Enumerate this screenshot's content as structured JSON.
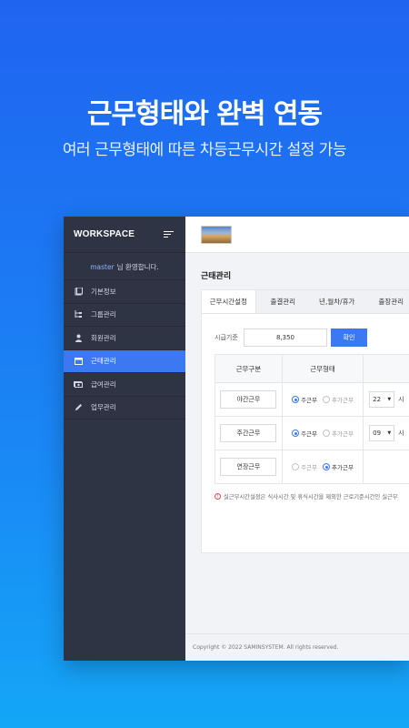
{
  "headline": "근무형태와 완벽 연동",
  "subline": "여러 근무형태에 따른 차등근무시간 설정 가능",
  "sidebar": {
    "workspace_title": "WORKSPACE",
    "welcome_user": "master",
    "welcome_text": "님 환영합니다.",
    "items": [
      {
        "label": "기본정보",
        "icon": "book-icon"
      },
      {
        "label": "그룹관리",
        "icon": "tree-icon"
      },
      {
        "label": "회원관리",
        "icon": "user-icon"
      },
      {
        "label": "근태관리",
        "icon": "calendar-icon",
        "active": true
      },
      {
        "label": "급여관리",
        "icon": "money-icon"
      },
      {
        "label": "업무관리",
        "icon": "pencil-icon"
      }
    ]
  },
  "main": {
    "page_title": "근태관리",
    "tabs": [
      "근무시간설정",
      "출결관리",
      "년,월차/휴가",
      "출장관리"
    ],
    "wage_label": "시급기준",
    "wage_value": "8,350",
    "confirm_label": "확인",
    "table": {
      "headers": [
        "근무구분",
        "근무형태"
      ],
      "rows": [
        {
          "type": "야간근무",
          "opt1": "주근무",
          "opt2": "추가근무",
          "selected": 1,
          "hour": "22",
          "unit": "시"
        },
        {
          "type": "주간근무",
          "opt1": "주근무",
          "opt2": "추가근무",
          "selected": 1,
          "hour": "09",
          "unit": "시"
        },
        {
          "type": "연장근무",
          "opt1": "주근무",
          "opt2": "추가근무",
          "selected": 2,
          "hour": "",
          "unit": ""
        }
      ]
    },
    "notice": "실근무시간설정은 식사시간 및 휴식시간을 제외한 근로기준시간인 실근무",
    "footer": "Copyright © 2022 SAMINSYSTEM. All rights reserved."
  },
  "colors": {
    "accent": "#3b78f2",
    "sidebar_bg": "#2f3444",
    "background_top": "#1f64f0",
    "background_bottom": "#14a6f7"
  }
}
